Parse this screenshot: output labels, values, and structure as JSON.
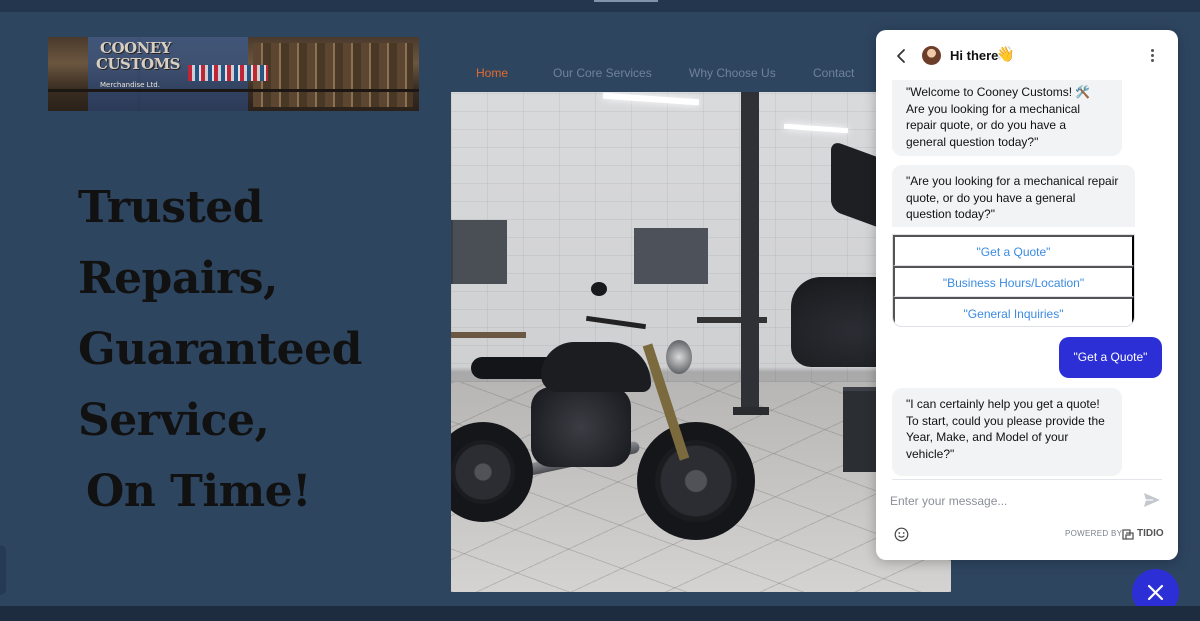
{
  "logo": {
    "title_line1": "COONEY",
    "title_line2": "CUSTOMS",
    "subtitle": "Merchandise Ltd."
  },
  "nav": {
    "items": [
      {
        "label": "Home",
        "active": true
      },
      {
        "label": "Our Core Services",
        "active": false
      },
      {
        "label": "Why Choose Us",
        "active": false
      },
      {
        "label": "Contact",
        "active": false
      }
    ]
  },
  "hero": {
    "lines": [
      "Trusted",
      "Repairs,",
      "Guaranteed",
      "Service,",
      "On Time!"
    ]
  },
  "chat": {
    "header_title": "Hi there",
    "header_emoji": "👋",
    "messages": {
      "welcome": "\"Welcome to Cooney Customs! 🛠️ Are you looking for a mechanical repair quote, or do you have a general question today?\"",
      "question": "\"Are you looking for a mechanical repair quote, or do you have a general question today?\"",
      "reply": "\"I can certainly help you get a quote! To start, could you please provide the Year, Make, and Model of your vehicle?\""
    },
    "options": [
      "\"Get a Quote\"",
      "\"Business Hours/Location\"",
      "\"General Inquiries\""
    ],
    "user_message": "\"Get a Quote\"",
    "input_placeholder": "Enter your message...",
    "powered_by": "POWERED BY",
    "brand": "TIDIO"
  },
  "colors": {
    "page_bg": "#2e4560",
    "nav_active": "#e36b2c",
    "chat_accent": "#2c2fd6",
    "option_text": "#3b8be0"
  }
}
